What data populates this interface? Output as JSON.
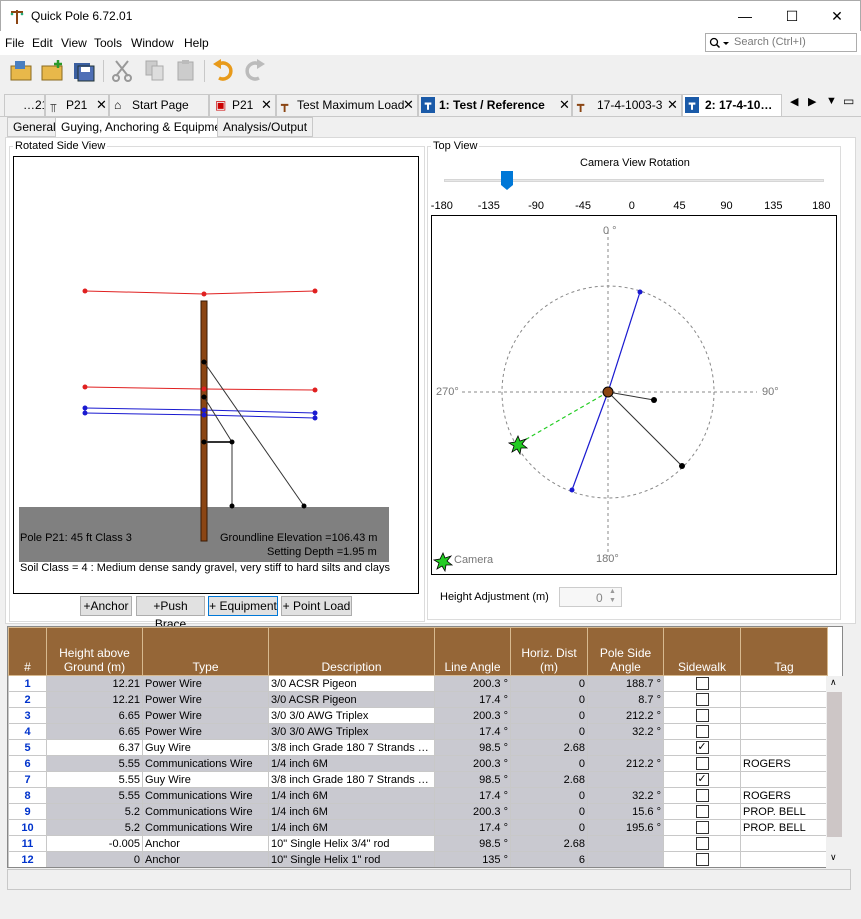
{
  "window": {
    "title": "Quick Pole 6.72.01",
    "minimize": "—",
    "maximize": "☐",
    "close": "✕"
  },
  "menu": [
    "File",
    "Edit",
    "View",
    "Tools",
    "Window",
    "Help"
  ],
  "search": {
    "placeholder": "Search (Ctrl+I)"
  },
  "doc_tabs": [
    {
      "label": "…21"
    },
    {
      "label": "P21"
    },
    {
      "label": "Start Page"
    },
    {
      "label": "P21"
    },
    {
      "label": "Test Maximum Load"
    },
    {
      "label": "1: Test / Reference"
    },
    {
      "label": "17-4-1003-3"
    },
    {
      "label": "2: 17-4-10…"
    }
  ],
  "sub_tabs": [
    "General",
    "Guying, Anchoring & Equipment",
    "Analysis/Output"
  ],
  "side_view": {
    "group_label": "Rotated Side View",
    "pole_label": "Pole P21: 45 ft Class 3",
    "groundline": "Groundline Elevation =106.43 m",
    "setting_depth": "Setting Depth =1.95 m",
    "soil_class": "Soil Class = 4 : Medium dense sandy gravel, very stiff to hard silts and clays"
  },
  "buttons": [
    "+Anchor",
    "+Push Brace",
    "+ Equipment",
    "+ Point Load"
  ],
  "top_view": {
    "group_label": "Top View",
    "rotation_label": "Camera View Rotation",
    "slider_ticks": [
      "-180",
      "-135",
      "-90",
      "-45",
      "0",
      "45",
      "90",
      "135",
      "180"
    ],
    "slider_value": -120,
    "compass": {
      "n": "0 °",
      "e": "90°",
      "s": "180°",
      "w": "270°"
    },
    "camera_label": "Camera",
    "height_adjust_label": "Height Adjustment (m)",
    "height_adjust_value": "0"
  },
  "table": {
    "headers": [
      "#",
      "Height above Ground (m)",
      "Type",
      "Description",
      "Line Angle",
      "Horiz. Dist (m)",
      "Pole Side Angle",
      "Sidewalk",
      "Tag"
    ],
    "rows": [
      {
        "n": "1",
        "h": "12.21",
        "type": "Power Wire",
        "desc": "3/0 ACSR Pigeon",
        "angle": "200.3 °",
        "dist": "0",
        "psa": "188.7 °",
        "sw": false,
        "tag": ""
      },
      {
        "n": "2",
        "h": "12.21",
        "type": "Power Wire",
        "desc": "3/0 ACSR Pigeon",
        "angle": "17.4 °",
        "dist": "0",
        "psa": "8.7 °",
        "sw": false,
        "tag": ""
      },
      {
        "n": "3",
        "h": "6.65",
        "type": "Power Wire",
        "desc": "3/0 3/0 AWG Triplex",
        "angle": "200.3 °",
        "dist": "0",
        "psa": "212.2 °",
        "sw": false,
        "tag": ""
      },
      {
        "n": "4",
        "h": "6.65",
        "type": "Power Wire",
        "desc": "3/0 3/0 AWG Triplex",
        "angle": "17.4 °",
        "dist": "0",
        "psa": "32.2 °",
        "sw": false,
        "tag": ""
      },
      {
        "n": "5",
        "h": "6.37",
        "type": "Guy Wire",
        "desc": "3/8 inch Grade 180 7 Strands  S…",
        "angle": "98.5 °",
        "dist": "2.68",
        "psa": "",
        "sw": true,
        "tag": ""
      },
      {
        "n": "6",
        "h": "5.55",
        "type": "Communications Wire",
        "desc": "1/4 inch 6M",
        "angle": "200.3 °",
        "dist": "0",
        "psa": "212.2 °",
        "sw": false,
        "tag": "ROGERS"
      },
      {
        "n": "7",
        "h": "5.55",
        "type": "Guy Wire",
        "desc": "3/8 inch Grade 180 7 Strands  S…",
        "angle": "98.5 °",
        "dist": "2.68",
        "psa": "",
        "sw": true,
        "tag": ""
      },
      {
        "n": "8",
        "h": "5.55",
        "type": "Communications Wire",
        "desc": "1/4 inch 6M",
        "angle": "17.4 °",
        "dist": "0",
        "psa": "32.2 °",
        "sw": false,
        "tag": "ROGERS"
      },
      {
        "n": "9",
        "h": "5.2",
        "type": "Communications Wire",
        "desc": "1/4 inch 6M",
        "angle": "200.3 °",
        "dist": "0",
        "psa": "15.6 °",
        "sw": false,
        "tag": "PROP. BELL"
      },
      {
        "n": "10",
        "h": "5.2",
        "type": "Communications Wire",
        "desc": "1/4 inch 6M",
        "angle": "17.4 °",
        "dist": "0",
        "psa": "195.6 °",
        "sw": false,
        "tag": "PROP. BELL"
      },
      {
        "n": "11",
        "h": "-0.005",
        "type": "Anchor",
        "desc": "10\" Single Helix 3/4\" rod",
        "angle": "98.5 °",
        "dist": "2.68",
        "psa": "",
        "sw": false,
        "tag": ""
      },
      {
        "n": "12",
        "h": "0",
        "type": "Anchor",
        "desc": "10\" Single Helix 1\" rod",
        "angle": "135 °",
        "dist": "6",
        "psa": "",
        "sw": false,
        "tag": ""
      }
    ]
  },
  "colors": {
    "header_brown": "#956637",
    "power_wire": "#e02020",
    "comm_wire": "#1a1ad0",
    "ground": "#808080",
    "pole": "#8b4513"
  }
}
